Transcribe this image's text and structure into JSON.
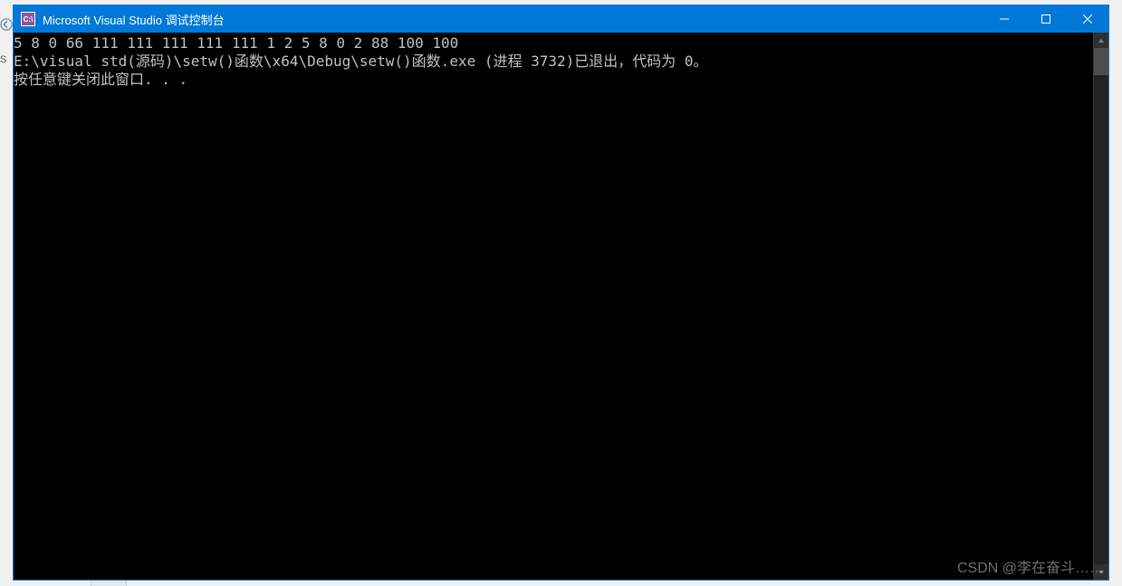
{
  "window": {
    "title": "Microsoft Visual Studio 调试控制台",
    "icon_label": "C:\\"
  },
  "console": {
    "line1": "5 8 0 66 111 111 111 111 111 1 2 5 8 0 2 88 100 100",
    "line2": "E:\\visual std(源码)\\setw()函数\\x64\\Debug\\setw()函数.exe (进程 3732)已退出，代码为 0。",
    "line3": "按任意键关闭此窗口. . ."
  },
  "controls": {
    "minimize": "minimize",
    "maximize": "maximize",
    "close": "close"
  },
  "watermark": "CSDN @李在奋斗……",
  "side_char": "S"
}
